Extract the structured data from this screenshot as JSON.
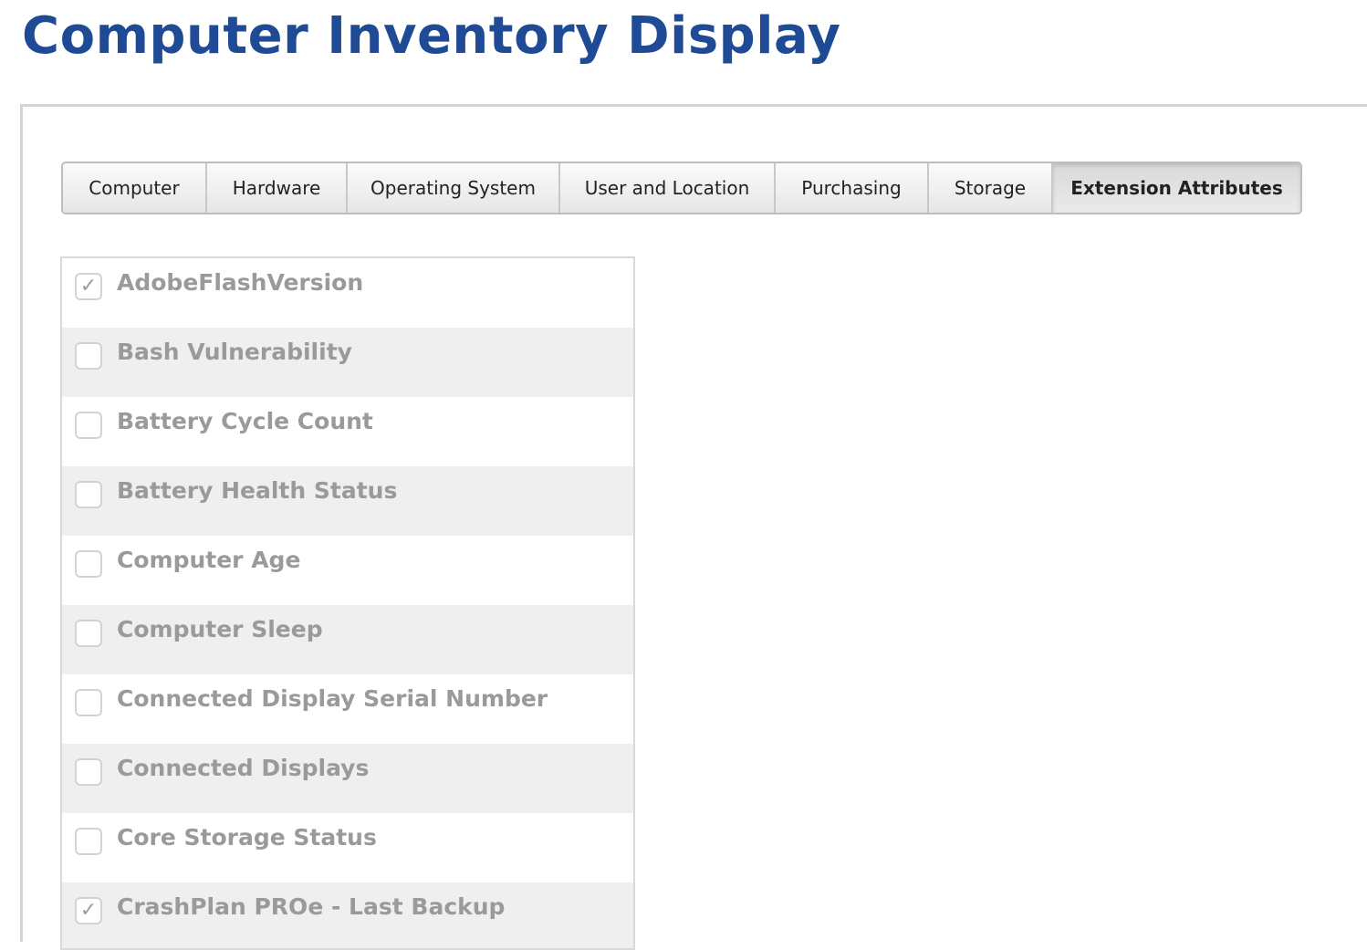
{
  "page": {
    "title": "Computer Inventory Display"
  },
  "colors": {
    "title": "#1f4a96",
    "label": "#9a9a9a",
    "row_alt": "#efefef"
  },
  "tabs": [
    {
      "label": "Computer",
      "active": false
    },
    {
      "label": "Hardware",
      "active": false
    },
    {
      "label": "Operating System",
      "active": false
    },
    {
      "label": "User and Location",
      "active": false
    },
    {
      "label": "Purchasing",
      "active": false
    },
    {
      "label": "Storage",
      "active": false
    },
    {
      "label": "Extension Attributes",
      "active": true
    }
  ],
  "attributes": [
    {
      "label": "AdobeFlashVersion",
      "checked": true
    },
    {
      "label": "Bash Vulnerability",
      "checked": false
    },
    {
      "label": "Battery Cycle Count",
      "checked": false
    },
    {
      "label": "Battery Health Status",
      "checked": false
    },
    {
      "label": "Computer Age",
      "checked": false
    },
    {
      "label": "Computer Sleep",
      "checked": false
    },
    {
      "label": "Connected Display Serial Number",
      "checked": false
    },
    {
      "label": "Connected Displays",
      "checked": false
    },
    {
      "label": "Core Storage Status",
      "checked": false
    },
    {
      "label": "CrashPlan PROe - Last Backup",
      "checked": true
    }
  ],
  "icons": {
    "check": "checkmark-icon"
  }
}
